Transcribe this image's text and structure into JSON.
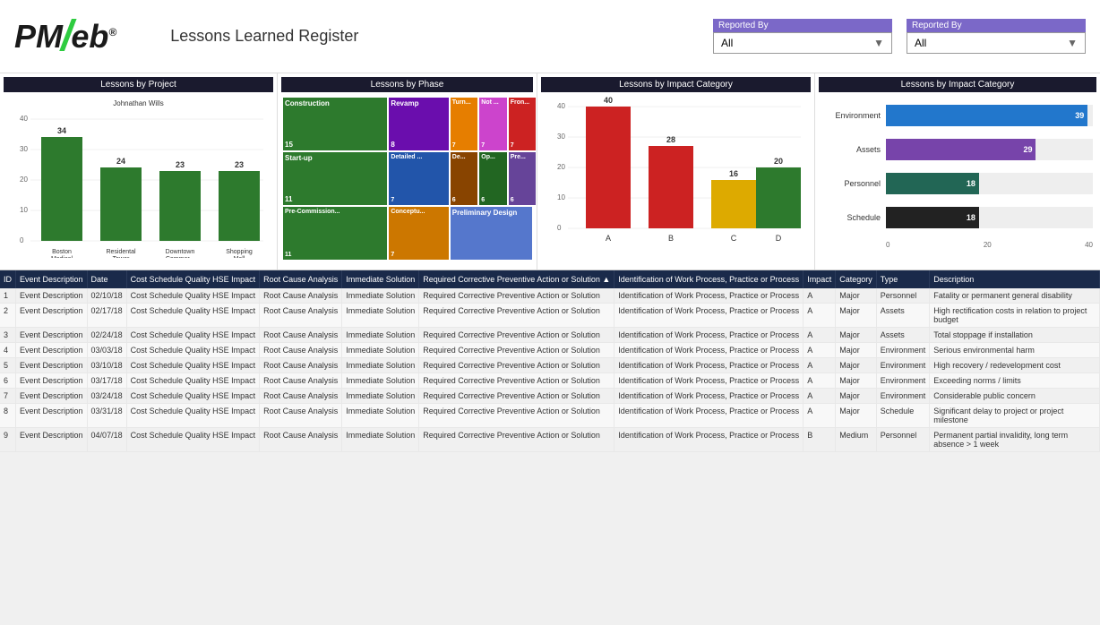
{
  "header": {
    "logo": "PMWeb",
    "title": "Lessons Learned Register",
    "filter1": {
      "label": "Reported By",
      "value": "All"
    },
    "filter2": {
      "label": "Reported By",
      "value": "All"
    }
  },
  "charts": {
    "chart1": {
      "title": "Lessons by Project",
      "annotation": "Johnathan Wills",
      "bars": [
        {
          "label": "Boston Medical Center",
          "value": 34,
          "color": "#2d7a2d"
        },
        {
          "label": "Residental Tower",
          "value": 24,
          "color": "#2d7a2d"
        },
        {
          "label": "Downtown Commer... Tower",
          "value": 23,
          "color": "#2d7a2d"
        },
        {
          "label": "Shopping Mall",
          "value": 23,
          "color": "#2d7a2d"
        }
      ],
      "yMax": 40
    },
    "chart2": {
      "title": "Lessons by Phase",
      "cells": [
        {
          "label": "Construction",
          "value": 15,
          "color": "#2d7a2d",
          "width": 45,
          "height": 55
        },
        {
          "label": "Revamp",
          "value": 8,
          "color": "#6a0dad",
          "width": 25,
          "height": 55
        },
        {
          "label": "Turn...",
          "value": 7,
          "color": "#e67e00",
          "width": 17,
          "height": 55
        },
        {
          "label": "Not ...",
          "value": 7,
          "color": "#cc44cc",
          "width": 17,
          "height": 55
        },
        {
          "label": "Fron...",
          "value": 7,
          "color": "#cc2222",
          "width": 17,
          "height": 55
        },
        {
          "label": "Start-up",
          "value": 11,
          "color": "#2d7a2d",
          "width": 45,
          "height": 50
        },
        {
          "label": "Detailed ...",
          "value": 7,
          "color": "#2255aa",
          "width": 25,
          "height": 50
        },
        {
          "label": "De...",
          "value": 6,
          "color": "#884400",
          "width": 17,
          "height": 50
        },
        {
          "label": "Op...",
          "value": 6,
          "color": "#226622",
          "width": 17,
          "height": 50
        },
        {
          "label": "Pre...",
          "value": 6,
          "color": "#664499",
          "width": 17,
          "height": 50
        },
        {
          "label": "Pre-Commission...",
          "value": 11,
          "color": "#2d7a2d",
          "width": 45,
          "height": 50
        },
        {
          "label": "Conceptu...",
          "value": 7,
          "color": "#cc7700",
          "width": 25,
          "height": 50
        },
        {
          "label": "Preliminary Design",
          "value": "",
          "color": "#5577cc",
          "width": 55,
          "height": 50
        }
      ]
    },
    "chart3": {
      "title": "Lessons by Impact Category",
      "bars": [
        {
          "label": "A",
          "value": 40,
          "color": "#cc2222"
        },
        {
          "label": "B",
          "value": 28,
          "color": "#cc2222"
        },
        {
          "label": "C",
          "value": 16,
          "color": "#ddaa00"
        },
        {
          "label": "D",
          "value": 20,
          "color": "#2d7a2d"
        }
      ],
      "yMax": 40
    },
    "chart4": {
      "title": "Lessons by Impact Category",
      "bars": [
        {
          "label": "Environment",
          "value": 39,
          "color": "#2277cc",
          "maxVal": 40
        },
        {
          "label": "Assets",
          "value": 29,
          "color": "#7744aa",
          "maxVal": 40
        },
        {
          "label": "Personnel",
          "value": 18,
          "color": "#226655",
          "maxVal": 40
        },
        {
          "label": "Schedule",
          "value": 18,
          "color": "#222222",
          "maxVal": 40
        }
      ]
    }
  },
  "table": {
    "columns": [
      "ID",
      "Event Description",
      "Date",
      "Cost Schedule Quality HSE Impact",
      "Root Cause Analysis",
      "Immediate Solution",
      "Required Corrective Preventive Action or Solution",
      "Identification of Work Process, Practice or Process",
      "Impact",
      "Category",
      "Type",
      "Description"
    ],
    "rows": [
      {
        "id": 1,
        "desc": "Event Description",
        "date": "02/10/18",
        "cost": "Cost Schedule Quality HSE Impact",
        "root": "Root Cause Analysis",
        "imm": "Immediate Solution",
        "req": "Required Corrective Preventive Action or Solution",
        "ident": "Identification of Work Process, Practice or Process",
        "impact": "A",
        "category": "Major",
        "type": "Personnel",
        "description": "Fatality or permanent general disability"
      },
      {
        "id": 2,
        "desc": "Event Description",
        "date": "02/17/18",
        "cost": "Cost Schedule Quality HSE Impact",
        "root": "Root Cause Analysis",
        "imm": "Immediate Solution",
        "req": "Required Corrective Preventive Action or Solution",
        "ident": "Identification of Work Process, Practice or Process",
        "impact": "A",
        "category": "Major",
        "type": "Assets",
        "description": "High rectification costs in relation to project budget"
      },
      {
        "id": 3,
        "desc": "Event Description",
        "date": "02/24/18",
        "cost": "Cost Schedule Quality HSE Impact",
        "root": "Root Cause Analysis",
        "imm": "Immediate Solution",
        "req": "Required Corrective Preventive Action or Solution",
        "ident": "Identification of Work Process, Practice or Process",
        "impact": "A",
        "category": "Major",
        "type": "Assets",
        "description": "Total stoppage if installation"
      },
      {
        "id": 4,
        "desc": "Event Description",
        "date": "03/03/18",
        "cost": "Cost Schedule Quality HSE Impact",
        "root": "Root Cause Analysis",
        "imm": "Immediate Solution",
        "req": "Required Corrective Preventive Action or Solution",
        "ident": "Identification of Work Process, Practice or Process",
        "impact": "A",
        "category": "Major",
        "type": "Environment",
        "description": "Serious environmental harm"
      },
      {
        "id": 5,
        "desc": "Event Description",
        "date": "03/10/18",
        "cost": "Cost Schedule Quality HSE Impact",
        "root": "Root Cause Analysis",
        "imm": "Immediate Solution",
        "req": "Required Corrective Preventive Action or Solution",
        "ident": "Identification of Work Process, Practice or Process",
        "impact": "A",
        "category": "Major",
        "type": "Environment",
        "description": "High recovery / redevelopment cost"
      },
      {
        "id": 6,
        "desc": "Event Description",
        "date": "03/17/18",
        "cost": "Cost Schedule Quality HSE Impact",
        "root": "Root Cause Analysis",
        "imm": "Immediate Solution",
        "req": "Required Corrective Preventive Action or Solution",
        "ident": "Identification of Work Process, Practice or Process",
        "impact": "A",
        "category": "Major",
        "type": "Environment",
        "description": "Exceeding norms / limits"
      },
      {
        "id": 7,
        "desc": "Event Description",
        "date": "03/24/18",
        "cost": "Cost Schedule Quality HSE Impact",
        "root": "Root Cause Analysis",
        "imm": "Immediate Solution",
        "req": "Required Corrective Preventive Action or Solution",
        "ident": "Identification of Work Process, Practice or Process",
        "impact": "A",
        "category": "Major",
        "type": "Environment",
        "description": "Considerable public concern"
      },
      {
        "id": 8,
        "desc": "Event Description",
        "date": "03/31/18",
        "cost": "Cost Schedule Quality HSE Impact",
        "root": "Root Cause Analysis",
        "imm": "Immediate Solution",
        "req": "Required Corrective Preventive Action or Solution",
        "ident": "Identification of Work Process, Practice or Process",
        "impact": "A",
        "category": "Major",
        "type": "Schedule",
        "description": "Significant delay to project or project milestone"
      },
      {
        "id": 9,
        "desc": "Event Description",
        "date": "04/07/18",
        "cost": "Cost Schedule Quality HSE Impact",
        "root": "Root Cause Analysis",
        "imm": "Immediate Solution",
        "req": "Required Corrective Preventive Action or Solution",
        "ident": "Identification of Work Process, Practice or Process",
        "impact": "B",
        "category": "Medium",
        "type": "Personnel",
        "description": "Permanent partial invalidity, long term absence > 1 week"
      }
    ]
  }
}
